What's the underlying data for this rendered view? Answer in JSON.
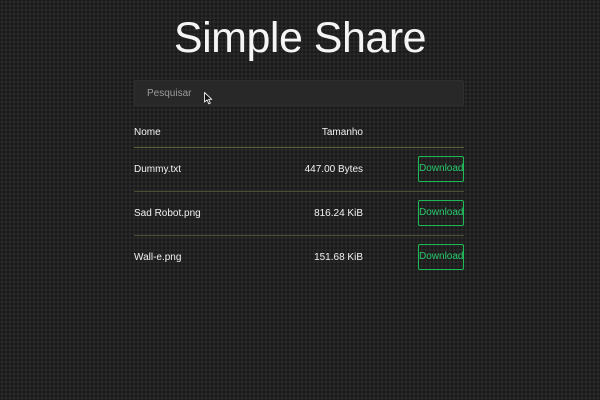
{
  "app": {
    "title": "Simple Share"
  },
  "search": {
    "placeholder": "Pesquisar",
    "value": ""
  },
  "table": {
    "headers": {
      "name": "Nome",
      "size": "Tamanho"
    },
    "rows": [
      {
        "name": "Dummy.txt",
        "size": "447.00 Bytes",
        "action": "Download"
      },
      {
        "name": "Sad Robot.png",
        "size": "816.24 KiB",
        "action": "Download"
      },
      {
        "name": "Wall-e.png",
        "size": "151.68 KiB",
        "action": "Download"
      }
    ]
  },
  "colors": {
    "background": "#222222",
    "accent": "#27c86a",
    "divider": "#5a5f3a"
  },
  "icons": {
    "cursor": "mouse-pointer-icon"
  }
}
